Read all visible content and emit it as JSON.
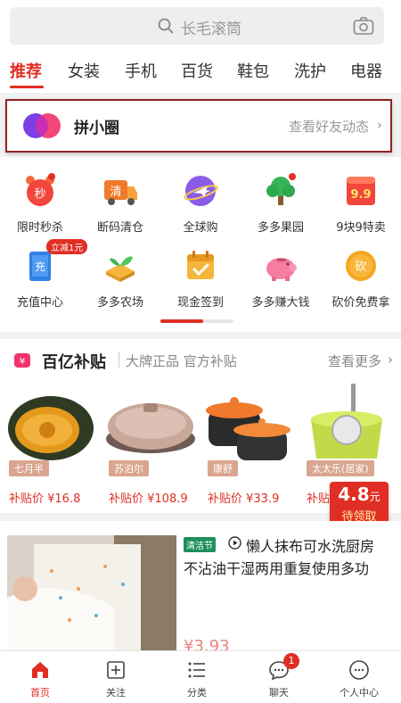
{
  "search": {
    "placeholder": "长毛滚筒"
  },
  "tabs": [
    {
      "label": "推荐",
      "active": true
    },
    {
      "label": "女装"
    },
    {
      "label": "手机"
    },
    {
      "label": "百货"
    },
    {
      "label": "鞋包"
    },
    {
      "label": "洗护"
    },
    {
      "label": "电器"
    }
  ],
  "circle": {
    "title": "拼小圈",
    "link": "查看好友动态",
    "arrow": "›"
  },
  "grid": {
    "items": [
      {
        "label": "限时秒杀",
        "icon": "alarm-clock-icon"
      },
      {
        "label": "断码清仓",
        "icon": "truck-icon"
      },
      {
        "label": "全球购",
        "icon": "airplane-icon"
      },
      {
        "label": "多多果园",
        "icon": "tree-icon"
      },
      {
        "label": "9块9特卖",
        "icon": "price-tag-icon"
      },
      {
        "label": "充值中心",
        "icon": "phone-recharge-icon",
        "badge": "立减1元"
      },
      {
        "label": "多多农场",
        "icon": "sprout-icon"
      },
      {
        "label": "现金签到",
        "icon": "calendar-icon"
      },
      {
        "label": "多多赚大钱",
        "icon": "piggy-bank-icon"
      },
      {
        "label": "砍价免费拿",
        "icon": "bargain-coin-icon"
      }
    ],
    "glyphs": {
      "miao": "秒",
      "qing": "清",
      "chong": "充",
      "kan": "砍",
      "nine": "9.9"
    },
    "progress": 0.58
  },
  "subsidy": {
    "title": "百亿补贴",
    "desc": "大牌正品 官方补贴",
    "more": "查看更多",
    "arrow": "›",
    "products": [
      {
        "brand": "七月半",
        "price": "补贴价 ¥16.8"
      },
      {
        "brand": "苏泊尔",
        "price": "补贴价 ¥108.9"
      },
      {
        "brand": "康舒",
        "price": "补贴价 ¥33.9"
      },
      {
        "brand": "太太乐(居家)",
        "price": "补贴价 ¥"
      }
    ],
    "coupon": {
      "amount": "4.8",
      "unit": "元",
      "text": "待领取",
      "coin": "¥"
    }
  },
  "feed": {
    "tag": "清洁节",
    "title_line1": "懒人抹布可水洗厨房",
    "title_line2": "不沾油干湿两用重复使用多功",
    "price_partial": "¥3.93"
  },
  "nav": [
    {
      "label": "首页",
      "icon": "home-icon",
      "active": true
    },
    {
      "label": "关注",
      "icon": "follow-icon"
    },
    {
      "label": "分类",
      "icon": "category-icon"
    },
    {
      "label": "聊天",
      "icon": "chat-icon",
      "badge": "1"
    },
    {
      "label": "个人中心",
      "icon": "profile-icon"
    }
  ],
  "colors": {
    "accent": "#e02e24",
    "tag_brown": "#d9a58f"
  }
}
